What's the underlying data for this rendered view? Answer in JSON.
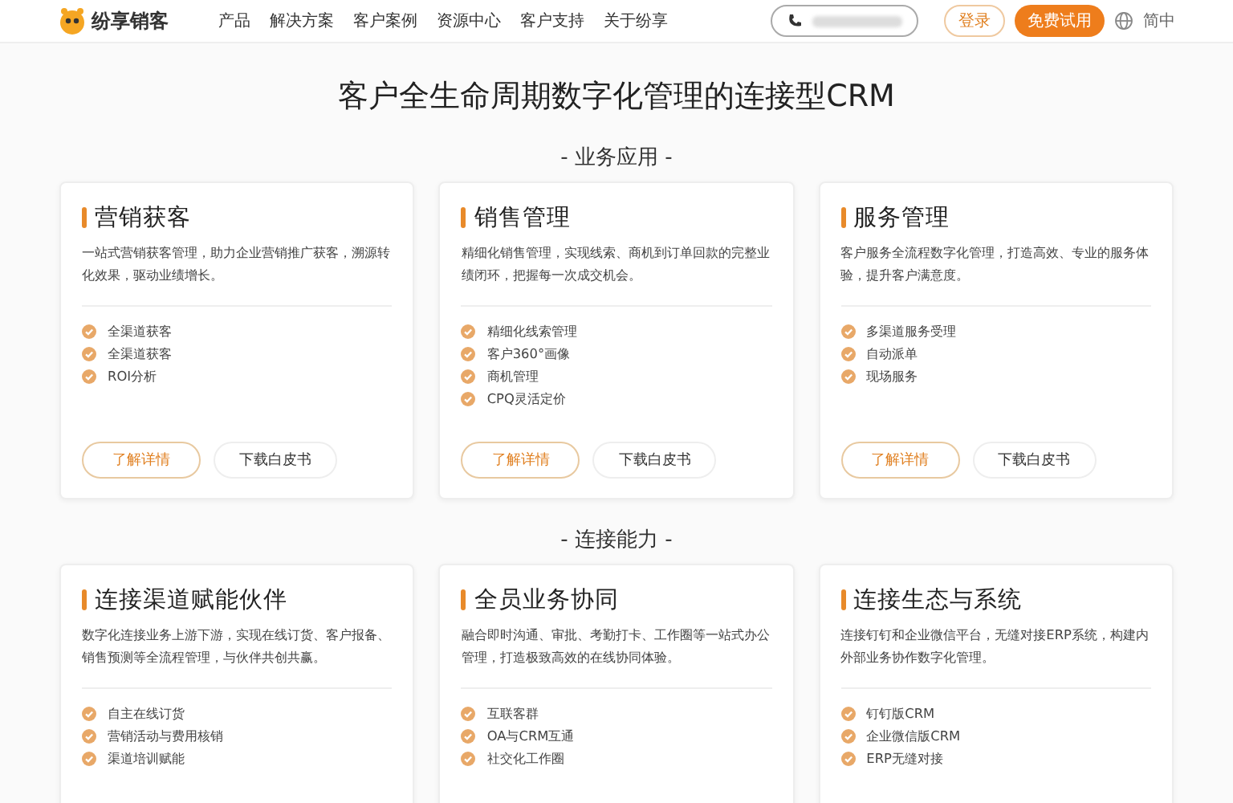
{
  "header": {
    "logo": "纷享销客",
    "nav": [
      "产品",
      "解决方案",
      "客户案例",
      "资源中心",
      "客户支持",
      "关于纷享"
    ],
    "login": "登录",
    "trial": "免费试用",
    "language": "简中"
  },
  "headline": "客户全生命周期数字化管理的连接型CRM",
  "sections": [
    {
      "title": "- 业务应用 -",
      "cards": [
        {
          "title": "营销获客",
          "desc": "一站式营销获客管理，助力企业营销推广获客，溯源转化效果，驱动业绩增长。",
          "features": [
            "全渠道获客",
            "全渠道获客",
            "ROI分析"
          ],
          "buttons": [
            "了解详情",
            "下载白皮书"
          ]
        },
        {
          "title": "销售管理",
          "desc": "精细化销售管理，实现线索、商机到订单回款的完整业绩闭环，把握每一次成交机会。",
          "features": [
            "精细化线索管理",
            "客户360°画像",
            "商机管理",
            "CPQ灵活定价"
          ],
          "buttons": [
            "了解详情",
            "下载白皮书"
          ]
        },
        {
          "title": "服务管理",
          "desc": "客户服务全流程数字化管理，打造高效、专业的服务体验，提升客户满意度。",
          "features": [
            "多渠道服务受理",
            "自动派单",
            "现场服务"
          ],
          "buttons": [
            "了解详情",
            "下载白皮书"
          ]
        }
      ]
    },
    {
      "title": "- 连接能力 -",
      "cards": [
        {
          "title": "连接渠道赋能伙伴",
          "desc": "数字化连接业务上游下游，实现在线订货、客户报备、销售预测等全流程管理，与伙伴共创共赢。",
          "features": [
            "自主在线订货",
            "营销活动与费用核销",
            "渠道培训赋能"
          ]
        },
        {
          "title": "全员业务协同",
          "desc": "融合即时沟通、审批、考勤打卡、工作圈等一站式办公管理，打造极致高效的在线协同体验。",
          "features": [
            "互联客群",
            "OA与CRM互通",
            "社交化工作圈"
          ]
        },
        {
          "title": "连接生态与系统",
          "desc": "连接钉钉和企业微信平台，无缝对接ERP系统，构建内外部业务协作数字化管理。",
          "features": [
            "钉钉版CRM",
            "企业微信版CRM",
            "ERP无缝对接"
          ]
        }
      ]
    }
  ]
}
